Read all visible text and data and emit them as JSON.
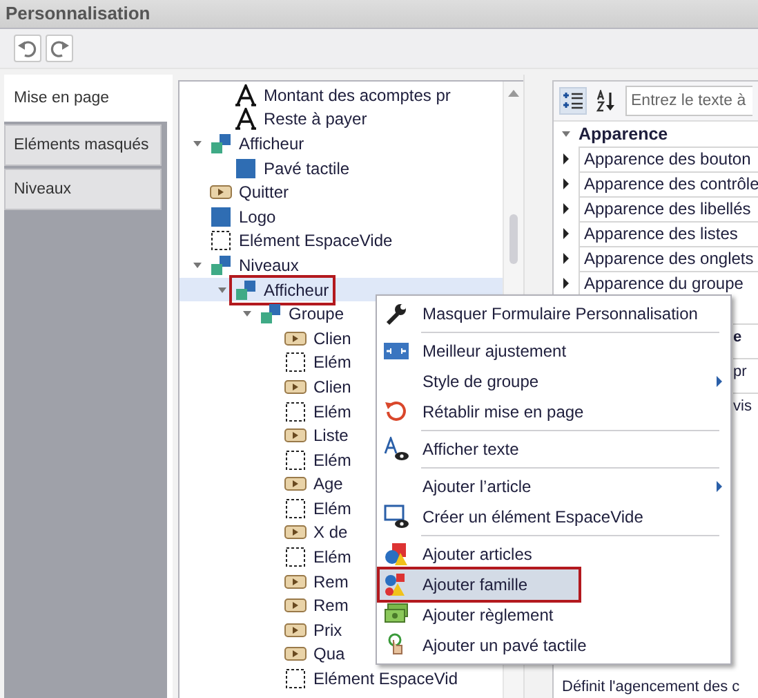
{
  "window": {
    "title": "Personnalisation"
  },
  "toolbar": {
    "buttons": [
      {
        "kind": "undo"
      },
      {
        "kind": "redo"
      }
    ]
  },
  "tabs": [
    {
      "label": "Mise en page",
      "selected": true
    },
    {
      "label": "Eléments masqués",
      "selected": false
    },
    {
      "label": "Niveaux",
      "selected": false
    }
  ],
  "tree": {
    "items": [
      {
        "kind": "hidden_parent",
        "children": [
          {
            "kind": "text",
            "label": "Montant des acomptes pr",
            "selected": false
          },
          {
            "kind": "text",
            "label": "Reste à payer",
            "selected": false
          }
        ]
      },
      {
        "kind": "group",
        "label": "Afficheur",
        "selected": false,
        "expanded": true,
        "children": [
          {
            "kind": "tile",
            "label": "Pavé tactile",
            "selected": false
          }
        ]
      },
      {
        "kind": "button",
        "label": "Quitter",
        "selected": false
      },
      {
        "kind": "tile",
        "label": "Logo",
        "selected": false
      },
      {
        "kind": "space",
        "label": "Elément EspaceVide",
        "selected": false
      },
      {
        "kind": "group",
        "label": "Niveaux",
        "selected": false,
        "expanded": true,
        "children": [
          {
            "kind": "group",
            "label": "Afficheur",
            "selected": true,
            "outlined": true,
            "expanded": true,
            "children": [
              {
                "kind": "group",
                "label": "Groupe",
                "selected": false,
                "expanded": true,
                "children": [
                  {
                    "kind": "button",
                    "label": "Clien",
                    "selected": false
                  },
                  {
                    "kind": "space",
                    "label": "Elém",
                    "selected": false
                  },
                  {
                    "kind": "button",
                    "label": "Clien",
                    "selected": false
                  },
                  {
                    "kind": "space",
                    "label": "Elém",
                    "selected": false
                  },
                  {
                    "kind": "button",
                    "label": "Liste",
                    "selected": false
                  },
                  {
                    "kind": "space",
                    "label": "Elém",
                    "selected": false
                  },
                  {
                    "kind": "button",
                    "label": "Age",
                    "selected": false
                  },
                  {
                    "kind": "space",
                    "label": "Elém",
                    "selected": false
                  },
                  {
                    "kind": "button",
                    "label": "X de",
                    "selected": false
                  },
                  {
                    "kind": "space",
                    "label": "Elém",
                    "selected": false
                  },
                  {
                    "kind": "button",
                    "label": "Rem",
                    "selected": false
                  },
                  {
                    "kind": "button",
                    "label": "Rem",
                    "selected": false
                  },
                  {
                    "kind": "button",
                    "label": "Prix",
                    "selected": false
                  },
                  {
                    "kind": "button",
                    "label": "Qua",
                    "selected": false
                  },
                  {
                    "kind": "space",
                    "label": "Elément EspaceVid",
                    "selected": false
                  }
                ]
              }
            ]
          }
        ]
      }
    ]
  },
  "properties": {
    "search": {
      "placeholder": "Entrez le texte à"
    },
    "sort_buttons": [
      {
        "kind": "categorized",
        "selected": true
      },
      {
        "kind": "alphabetical",
        "selected": false
      }
    ],
    "category": {
      "label": "Apparence",
      "expanded": true
    },
    "rows": [
      {
        "label": "Apparence des bouton",
        "expanded": false
      },
      {
        "label": "Apparence des contrôle",
        "expanded": false
      },
      {
        "label": "Apparence des libellés",
        "expanded": false
      },
      {
        "label": "Apparence des listes",
        "expanded": false
      },
      {
        "label": "Apparence des onglets",
        "expanded": false
      },
      {
        "label": "Apparence du groupe",
        "expanded": false
      }
    ],
    "covered_category": {
      "label": "e"
    },
    "covered_rows": [
      {
        "label": "pr"
      },
      {
        "label": "vis"
      }
    ],
    "description": "Définit l'agencement des c"
  },
  "context_menu": {
    "sections": [
      [
        {
          "label": "Masquer Formulaire Personnalisation",
          "submenu": false,
          "selected": false
        }
      ],
      [
        {
          "label": "Meilleur ajustement",
          "submenu": false,
          "selected": false
        },
        {
          "label": "Style de groupe",
          "submenu": true,
          "selected": false
        },
        {
          "label": "Rétablir mise en page",
          "submenu": false,
          "selected": false
        }
      ],
      [
        {
          "label": "Afficher texte",
          "submenu": false,
          "selected": false
        }
      ],
      [
        {
          "label": "Ajouter l’article",
          "submenu": true,
          "selected": false
        },
        {
          "label": "Créer un élément EspaceVide",
          "submenu": false,
          "selected": false
        }
      ],
      [
        {
          "label": "Ajouter articles",
          "submenu": false,
          "selected": false
        },
        {
          "label": "Ajouter famille",
          "submenu": false,
          "selected": true,
          "outlined": true
        },
        {
          "label": "Ajouter règlement",
          "submenu": false,
          "selected": false
        },
        {
          "label": "Ajouter un pavé tactile",
          "submenu": false,
          "selected": false
        }
      ]
    ]
  }
}
